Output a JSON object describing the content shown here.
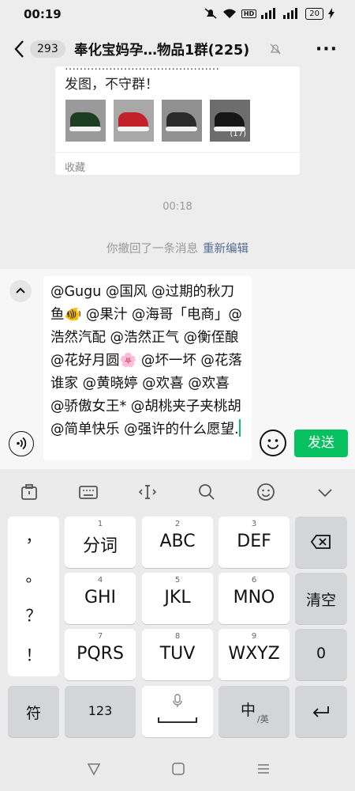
{
  "status": {
    "time": "00:19",
    "battery": "20"
  },
  "header": {
    "unread": "293",
    "title": "奉化宝妈孕…物品1群(225)",
    "more": "···"
  },
  "message": {
    "text_cut": "……………………………………",
    "text": "发图，不守群！",
    "image_count": "(17)",
    "collect": "收藏"
  },
  "timestamp": "00:18",
  "recall": {
    "text": "你撤回了一条消息",
    "edit": "重新编辑"
  },
  "input": {
    "text": "@Gugu @国风 @过期的秋刀鱼🐠 @果汁 @海哥「电商」@浩然汽配 @浩然正气 @衡侄酿 @花好月圆🌸 @坏一坏 @花落谁家 @黄晓婷 @欢喜 @欢喜 @骄傲女王* @胡桃夹子夹桃胡 @简单快乐 @强许的什么愿望.",
    "send": "发送"
  },
  "keyboard": {
    "punct": [
      "，",
      "。",
      "？",
      "！"
    ],
    "keys": [
      {
        "num": "1",
        "label": "分词"
      },
      {
        "num": "2",
        "label": "ABC"
      },
      {
        "num": "3",
        "label": "DEF"
      },
      {
        "num": "4",
        "label": "GHI"
      },
      {
        "num": "5",
        "label": "JKL"
      },
      {
        "num": "6",
        "label": "MNO"
      },
      {
        "num": "7",
        "label": "PQRS"
      },
      {
        "num": "8",
        "label": "TUV"
      },
      {
        "num": "9",
        "label": "WXYZ"
      }
    ],
    "clear": "清空",
    "zero": "0",
    "symbol": "符",
    "num123": "123",
    "lang": "中",
    "lang_sub": "/英"
  }
}
